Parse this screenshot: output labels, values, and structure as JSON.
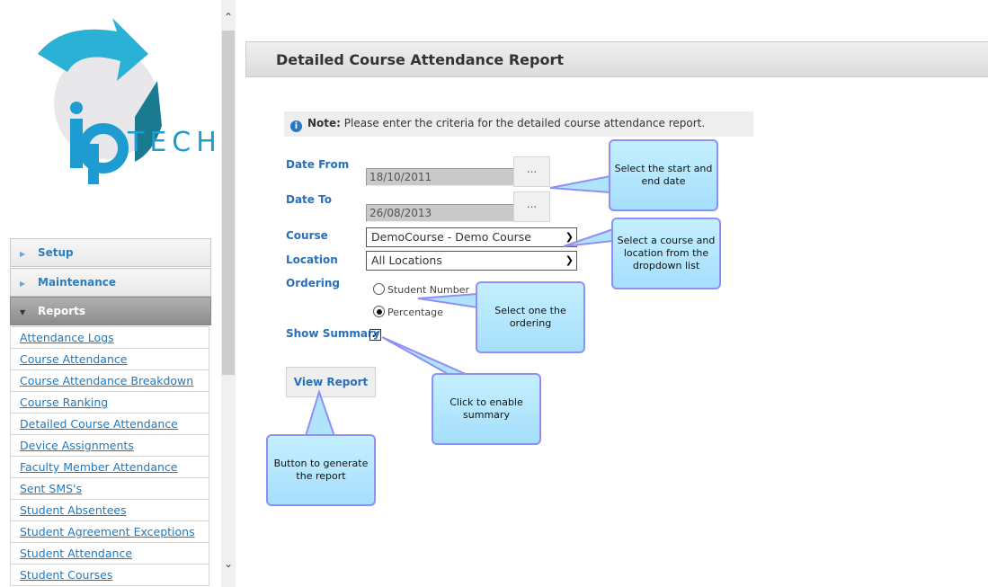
{
  "logo": {
    "text": "iP TECH"
  },
  "sidebar": {
    "sections": [
      {
        "label": "Setup"
      },
      {
        "label": "Maintenance"
      },
      {
        "label": "Reports"
      }
    ],
    "links": [
      "Attendance Logs",
      "Course Attendance",
      "Course Attendance Breakdown",
      "Course Ranking",
      "Detailed Course Attendance",
      "Device Assignments",
      "Faculty Member Attendance",
      "Sent SMS's",
      "Student Absentees",
      "Student Agreement Exceptions",
      "Student Attendance",
      "Student Courses"
    ]
  },
  "header": {
    "title": "Detailed Course Attendance Report"
  },
  "note": {
    "label": "Note:",
    "text": "Please enter the criteria for the detailed course attendance report."
  },
  "form": {
    "date_from_label": "Date From",
    "date_from": "18/10/2011",
    "date_to_label": "Date To",
    "date_to": "26/08/2013",
    "picker_label": "...",
    "course_label": "Course",
    "course": "DemoCourse - Demo Course",
    "location_label": "Location",
    "location": "All Locations",
    "ordering_label": "Ordering",
    "ordering_options": [
      "Student Number",
      "Percentage"
    ],
    "ordering_selected": "Percentage",
    "summary_label": "Show Summary",
    "summary_checked": true,
    "view_button": "View Report"
  },
  "callouts": [
    "Select the start and end date",
    "Select a course and location from the dropdown list",
    "Select one the ordering",
    "Click to enable summary",
    "Button to generate the report"
  ],
  "colors": {
    "accent": "#2a70b8",
    "link": "#1a7ac6",
    "callout_border": "#8f8ff5"
  }
}
